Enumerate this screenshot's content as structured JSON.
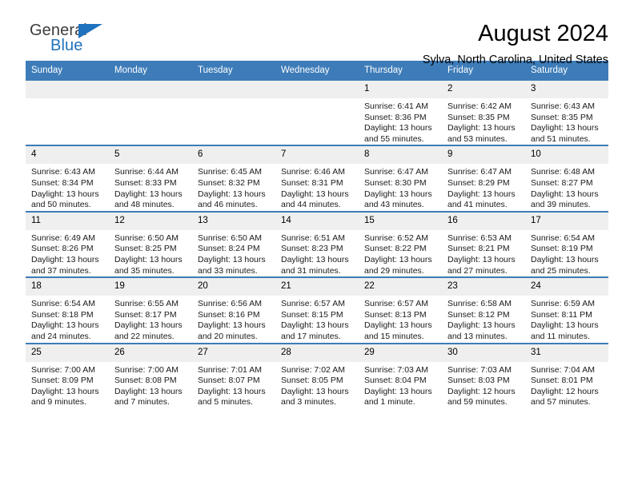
{
  "brand": {
    "name_top": "General",
    "name_bottom": "Blue",
    "accent_color": "#1f72bd",
    "triangle_icon": "triangle-icon"
  },
  "header": {
    "month_title": "August 2024",
    "location": "Sylva, North Carolina, United States"
  },
  "calendar": {
    "header_bg": "#3d7cb8",
    "day_band_bg": "#efefef",
    "weekday_headers": [
      "Sunday",
      "Monday",
      "Tuesday",
      "Wednesday",
      "Thursday",
      "Friday",
      "Saturday"
    ],
    "weeks": [
      [
        {
          "day": "",
          "empty": true,
          "sunrise": "",
          "sunset": "",
          "daylight_line1": "",
          "daylight_line2": ""
        },
        {
          "day": "",
          "empty": true,
          "sunrise": "",
          "sunset": "",
          "daylight_line1": "",
          "daylight_line2": ""
        },
        {
          "day": "",
          "empty": true,
          "sunrise": "",
          "sunset": "",
          "daylight_line1": "",
          "daylight_line2": ""
        },
        {
          "day": "",
          "empty": true,
          "sunrise": "",
          "sunset": "",
          "daylight_line1": "",
          "daylight_line2": ""
        },
        {
          "day": "1",
          "empty": false,
          "sunrise": "Sunrise: 6:41 AM",
          "sunset": "Sunset: 8:36 PM",
          "daylight_line1": "Daylight: 13 hours",
          "daylight_line2": "and 55 minutes."
        },
        {
          "day": "2",
          "empty": false,
          "sunrise": "Sunrise: 6:42 AM",
          "sunset": "Sunset: 8:35 PM",
          "daylight_line1": "Daylight: 13 hours",
          "daylight_line2": "and 53 minutes."
        },
        {
          "day": "3",
          "empty": false,
          "sunrise": "Sunrise: 6:43 AM",
          "sunset": "Sunset: 8:35 PM",
          "daylight_line1": "Daylight: 13 hours",
          "daylight_line2": "and 51 minutes."
        }
      ],
      [
        {
          "day": "4",
          "empty": false,
          "sunrise": "Sunrise: 6:43 AM",
          "sunset": "Sunset: 8:34 PM",
          "daylight_line1": "Daylight: 13 hours",
          "daylight_line2": "and 50 minutes."
        },
        {
          "day": "5",
          "empty": false,
          "sunrise": "Sunrise: 6:44 AM",
          "sunset": "Sunset: 8:33 PM",
          "daylight_line1": "Daylight: 13 hours",
          "daylight_line2": "and 48 minutes."
        },
        {
          "day": "6",
          "empty": false,
          "sunrise": "Sunrise: 6:45 AM",
          "sunset": "Sunset: 8:32 PM",
          "daylight_line1": "Daylight: 13 hours",
          "daylight_line2": "and 46 minutes."
        },
        {
          "day": "7",
          "empty": false,
          "sunrise": "Sunrise: 6:46 AM",
          "sunset": "Sunset: 8:31 PM",
          "daylight_line1": "Daylight: 13 hours",
          "daylight_line2": "and 44 minutes."
        },
        {
          "day": "8",
          "empty": false,
          "sunrise": "Sunrise: 6:47 AM",
          "sunset": "Sunset: 8:30 PM",
          "daylight_line1": "Daylight: 13 hours",
          "daylight_line2": "and 43 minutes."
        },
        {
          "day": "9",
          "empty": false,
          "sunrise": "Sunrise: 6:47 AM",
          "sunset": "Sunset: 8:29 PM",
          "daylight_line1": "Daylight: 13 hours",
          "daylight_line2": "and 41 minutes."
        },
        {
          "day": "10",
          "empty": false,
          "sunrise": "Sunrise: 6:48 AM",
          "sunset": "Sunset: 8:27 PM",
          "daylight_line1": "Daylight: 13 hours",
          "daylight_line2": "and 39 minutes."
        }
      ],
      [
        {
          "day": "11",
          "empty": false,
          "sunrise": "Sunrise: 6:49 AM",
          "sunset": "Sunset: 8:26 PM",
          "daylight_line1": "Daylight: 13 hours",
          "daylight_line2": "and 37 minutes."
        },
        {
          "day": "12",
          "empty": false,
          "sunrise": "Sunrise: 6:50 AM",
          "sunset": "Sunset: 8:25 PM",
          "daylight_line1": "Daylight: 13 hours",
          "daylight_line2": "and 35 minutes."
        },
        {
          "day": "13",
          "empty": false,
          "sunrise": "Sunrise: 6:50 AM",
          "sunset": "Sunset: 8:24 PM",
          "daylight_line1": "Daylight: 13 hours",
          "daylight_line2": "and 33 minutes."
        },
        {
          "day": "14",
          "empty": false,
          "sunrise": "Sunrise: 6:51 AM",
          "sunset": "Sunset: 8:23 PM",
          "daylight_line1": "Daylight: 13 hours",
          "daylight_line2": "and 31 minutes."
        },
        {
          "day": "15",
          "empty": false,
          "sunrise": "Sunrise: 6:52 AM",
          "sunset": "Sunset: 8:22 PM",
          "daylight_line1": "Daylight: 13 hours",
          "daylight_line2": "and 29 minutes."
        },
        {
          "day": "16",
          "empty": false,
          "sunrise": "Sunrise: 6:53 AM",
          "sunset": "Sunset: 8:21 PM",
          "daylight_line1": "Daylight: 13 hours",
          "daylight_line2": "and 27 minutes."
        },
        {
          "day": "17",
          "empty": false,
          "sunrise": "Sunrise: 6:54 AM",
          "sunset": "Sunset: 8:19 PM",
          "daylight_line1": "Daylight: 13 hours",
          "daylight_line2": "and 25 minutes."
        }
      ],
      [
        {
          "day": "18",
          "empty": false,
          "sunrise": "Sunrise: 6:54 AM",
          "sunset": "Sunset: 8:18 PM",
          "daylight_line1": "Daylight: 13 hours",
          "daylight_line2": "and 24 minutes."
        },
        {
          "day": "19",
          "empty": false,
          "sunrise": "Sunrise: 6:55 AM",
          "sunset": "Sunset: 8:17 PM",
          "daylight_line1": "Daylight: 13 hours",
          "daylight_line2": "and 22 minutes."
        },
        {
          "day": "20",
          "empty": false,
          "sunrise": "Sunrise: 6:56 AM",
          "sunset": "Sunset: 8:16 PM",
          "daylight_line1": "Daylight: 13 hours",
          "daylight_line2": "and 20 minutes."
        },
        {
          "day": "21",
          "empty": false,
          "sunrise": "Sunrise: 6:57 AM",
          "sunset": "Sunset: 8:15 PM",
          "daylight_line1": "Daylight: 13 hours",
          "daylight_line2": "and 17 minutes."
        },
        {
          "day": "22",
          "empty": false,
          "sunrise": "Sunrise: 6:57 AM",
          "sunset": "Sunset: 8:13 PM",
          "daylight_line1": "Daylight: 13 hours",
          "daylight_line2": "and 15 minutes."
        },
        {
          "day": "23",
          "empty": false,
          "sunrise": "Sunrise: 6:58 AM",
          "sunset": "Sunset: 8:12 PM",
          "daylight_line1": "Daylight: 13 hours",
          "daylight_line2": "and 13 minutes."
        },
        {
          "day": "24",
          "empty": false,
          "sunrise": "Sunrise: 6:59 AM",
          "sunset": "Sunset: 8:11 PM",
          "daylight_line1": "Daylight: 13 hours",
          "daylight_line2": "and 11 minutes."
        }
      ],
      [
        {
          "day": "25",
          "empty": false,
          "sunrise": "Sunrise: 7:00 AM",
          "sunset": "Sunset: 8:09 PM",
          "daylight_line1": "Daylight: 13 hours",
          "daylight_line2": "and 9 minutes."
        },
        {
          "day": "26",
          "empty": false,
          "sunrise": "Sunrise: 7:00 AM",
          "sunset": "Sunset: 8:08 PM",
          "daylight_line1": "Daylight: 13 hours",
          "daylight_line2": "and 7 minutes."
        },
        {
          "day": "27",
          "empty": false,
          "sunrise": "Sunrise: 7:01 AM",
          "sunset": "Sunset: 8:07 PM",
          "daylight_line1": "Daylight: 13 hours",
          "daylight_line2": "and 5 minutes."
        },
        {
          "day": "28",
          "empty": false,
          "sunrise": "Sunrise: 7:02 AM",
          "sunset": "Sunset: 8:05 PM",
          "daylight_line1": "Daylight: 13 hours",
          "daylight_line2": "and 3 minutes."
        },
        {
          "day": "29",
          "empty": false,
          "sunrise": "Sunrise: 7:03 AM",
          "sunset": "Sunset: 8:04 PM",
          "daylight_line1": "Daylight: 13 hours",
          "daylight_line2": "and 1 minute."
        },
        {
          "day": "30",
          "empty": false,
          "sunrise": "Sunrise: 7:03 AM",
          "sunset": "Sunset: 8:03 PM",
          "daylight_line1": "Daylight: 12 hours",
          "daylight_line2": "and 59 minutes."
        },
        {
          "day": "31",
          "empty": false,
          "sunrise": "Sunrise: 7:04 AM",
          "sunset": "Sunset: 8:01 PM",
          "daylight_line1": "Daylight: 12 hours",
          "daylight_line2": "and 57 minutes."
        }
      ]
    ]
  }
}
